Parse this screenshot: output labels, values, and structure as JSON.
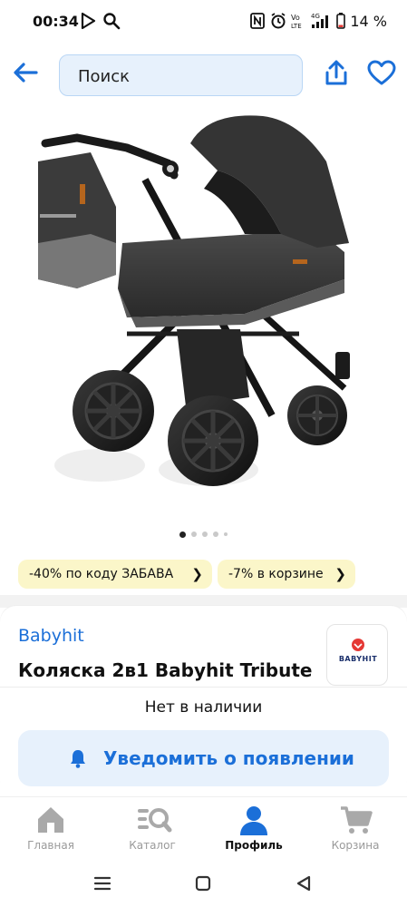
{
  "status_bar": {
    "time": "00:34",
    "battery": "14 %",
    "icons": [
      "play-icon",
      "search-icon",
      "nfc-icon",
      "alarm-icon",
      "volte-icon",
      "signal-4g-icon",
      "battery-icon"
    ]
  },
  "top_bar": {
    "search_text": "Поиск",
    "icons": [
      "back-arrow-icon",
      "share-icon",
      "heart-icon"
    ]
  },
  "gallery": {
    "image_subject": "stroller-photo",
    "dots_count": 5,
    "active_dot": 1
  },
  "promos": [
    {
      "label": "-40% по коду ЗАБАВА"
    },
    {
      "label": "-7% в корзине"
    }
  ],
  "product": {
    "brand": "Babyhit",
    "title": "Коляска 2в1 Babyhit Tribute",
    "brand_logo_text": "BABYHIT",
    "stock_status": "Нет в наличии",
    "notify_label": "Уведомить о появлении"
  },
  "bottom_nav": {
    "items": [
      {
        "label": "Главная",
        "icon": "home-icon",
        "active": false
      },
      {
        "label": "Каталог",
        "icon": "catalog-search-icon",
        "active": false
      },
      {
        "label": "Профиль",
        "icon": "profile-icon",
        "active": true
      },
      {
        "label": "Корзина",
        "icon": "cart-icon",
        "active": false
      }
    ]
  },
  "colors": {
    "accent": "#1b6fd8",
    "search_bg": "#e7f1fc",
    "promo_bg": "#fbf6c9",
    "inactive": "#9a9a9a"
  }
}
